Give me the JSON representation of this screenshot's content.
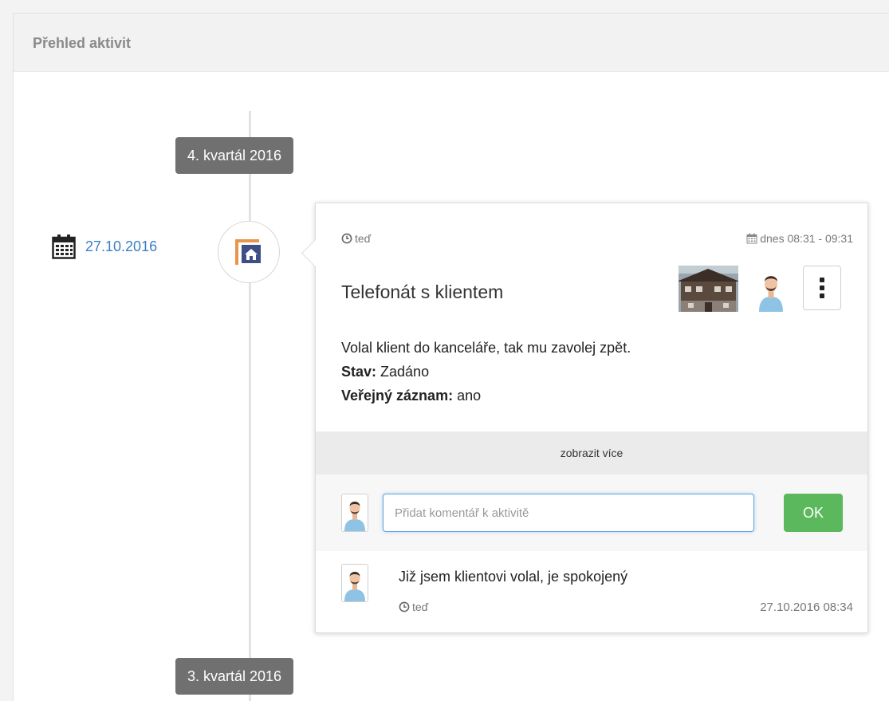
{
  "panel": {
    "title": "Přehled aktivit"
  },
  "timeline": {
    "quarters": [
      "4. kvartál 2016",
      "3. kvartál 2016"
    ],
    "date": "27.10.2016"
  },
  "activity": {
    "created": "teď",
    "schedule": "dnes 08:31 - 09:31",
    "title": "Telefonát s klientem",
    "description": "Volal klient do kanceláře, tak mu zavolej zpět.",
    "status_label": "Stav:",
    "status_value": "Zadáno",
    "public_label": "Veřejný záznam:",
    "public_value": "ano",
    "show_more": "zobrazit více"
  },
  "comment_form": {
    "placeholder": "Přidat komentář k aktivitě",
    "value": "",
    "submit_label": "OK"
  },
  "comments": [
    {
      "text": "Již jsem klientovi volal, je spokojený",
      "relative_time": "teď",
      "datetime": "27.10.2016 08:34"
    }
  ],
  "colors": {
    "accent": "#3b7fc4",
    "ok_button": "#5cb85c",
    "badge": "#707070"
  },
  "icons": [
    "calendar-icon",
    "house-activity-icon",
    "clock-icon",
    "kebab-menu-icon"
  ]
}
